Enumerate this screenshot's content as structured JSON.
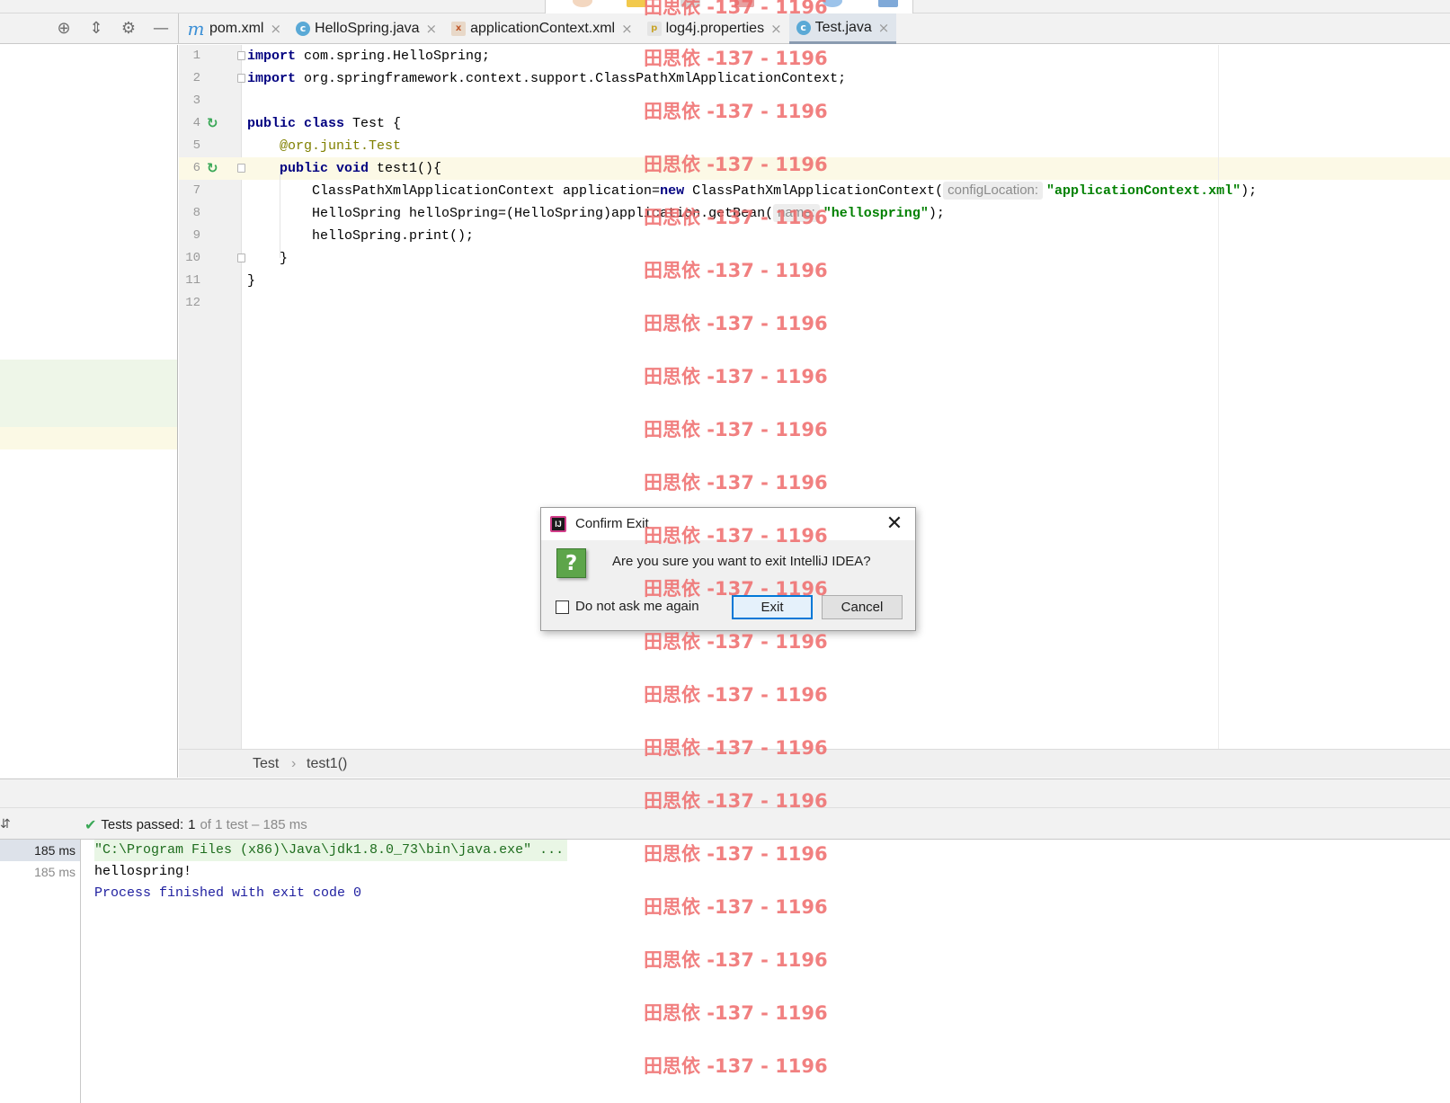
{
  "tabs": [
    {
      "icon": "maven-file-icon",
      "icon_glyph": "m",
      "label": "pom.xml"
    },
    {
      "icon": "java-class-icon",
      "icon_glyph": "c",
      "label": "HelloSpring.java"
    },
    {
      "icon": "xml-file-icon",
      "icon_glyph": "x",
      "label": "applicationContext.xml"
    },
    {
      "icon": "properties-file-icon",
      "icon_glyph": "p",
      "label": "log4j.properties"
    },
    {
      "icon": "java-class-icon",
      "icon_glyph": "c",
      "label": "Test.java"
    }
  ],
  "active_tab": "Test.java",
  "close_glyph": "×",
  "toolbar": {
    "locate_icon": "⊕",
    "collapse_icon": "⇕",
    "settings_icon": "⚙",
    "hide_icon": "—"
  },
  "editor": {
    "line_numbers": [
      "1",
      "2",
      "3",
      "4",
      "5",
      "6",
      "7",
      "8",
      "9",
      "10",
      "11",
      "12"
    ],
    "run_glyph": "↻",
    "lines": {
      "l1_kw": "import",
      "l1_rest": " com.spring.HelloSpring;",
      "l2_kw": "import",
      "l2_rest": " org.springframework.context.support.ClassPathXmlApplicationContext;",
      "l4_kw": "public class",
      "l4_rest": " Test {",
      "l5_at": "@org.junit.",
      "l5_ann": "Test",
      "l6_kw": "public void",
      "l6_rest": " test1(){",
      "l7_a": "ClassPathXmlApplicationContext application=",
      "l7_kw": "new",
      "l7_b": " ClassPathXmlApplicationContext(",
      "l7_hint": "configLocation:",
      "l7_str": "\"applicationContext.xml\"",
      "l7_end": ");",
      "l8_a": "HelloSpring helloSpring=(HelloSpring)application.getBean(",
      "l8_hint": "name:",
      "l8_str": "\"hellospring\"",
      "l8_end": ");",
      "l9": "helloSpring.print();",
      "l10": "}",
      "l11": "}"
    }
  },
  "breadcrumb": {
    "class": "Test",
    "separator": "›",
    "method": "test1()"
  },
  "run": {
    "pin_icon": "⇵",
    "check_glyph": "✔",
    "status_label": "Tests passed:",
    "status_count": "1",
    "status_detail": "of 1 test – 185 ms",
    "times": [
      "185 ms",
      "185 ms"
    ],
    "console": [
      "\"C:\\Program Files (x86)\\Java\\jdk1.8.0_73\\bin\\java.exe\" ...",
      "hellospring!",
      "Process finished with exit code 0"
    ]
  },
  "dialog": {
    "app_icon_glyph": "IJ",
    "title": "Confirm Exit",
    "close_glyph": "✕",
    "question_glyph": "?",
    "message": "Are you sure you want to exit IntelliJ IDEA?",
    "checkbox_label": "Do not ask me again",
    "checkbox_checked": false,
    "exit_label": "Exit",
    "cancel_label": "Cancel"
  },
  "watermark": "田思依 -137 - 1196",
  "colors": {
    "keyword": "#000080",
    "string": "#008000",
    "annotation": "#808000",
    "pass_green": "#3aa857",
    "watermark": "#ef6b6b",
    "dialog_focus": "#0078d7"
  }
}
